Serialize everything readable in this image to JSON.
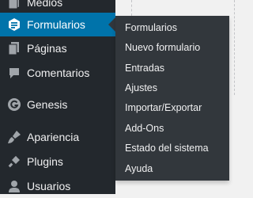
{
  "sidebar": {
    "items": [
      {
        "label": "Medios",
        "icon": "media-icon"
      },
      {
        "label": "Formularios",
        "icon": "forms-icon",
        "current": true
      },
      {
        "label": "Páginas",
        "icon": "pages-icon"
      },
      {
        "label": "Comentarios",
        "icon": "comments-icon"
      },
      {
        "label": "Genesis",
        "icon": "genesis-icon"
      },
      {
        "label": "Apariencia",
        "icon": "appearance-icon"
      },
      {
        "label": "Plugins",
        "icon": "plugins-icon"
      },
      {
        "label": "Usuarios",
        "icon": "users-icon"
      }
    ]
  },
  "submenu": {
    "items": [
      {
        "label": "Formularios"
      },
      {
        "label": "Nuevo formulario"
      },
      {
        "label": "Entradas"
      },
      {
        "label": "Ajustes"
      },
      {
        "label": "Importar/Exportar"
      },
      {
        "label": "Add-Ons"
      },
      {
        "label": "Estado del sistema"
      },
      {
        "label": "Ayuda"
      }
    ]
  },
  "colors": {
    "sidebar_bg": "#23282d",
    "submenu_bg": "#32373c",
    "current_bg": "#0073aa",
    "icon_color": "#a0a5aa",
    "text_color": "#f0f0f1",
    "page_bg": "#f1f1f1"
  }
}
